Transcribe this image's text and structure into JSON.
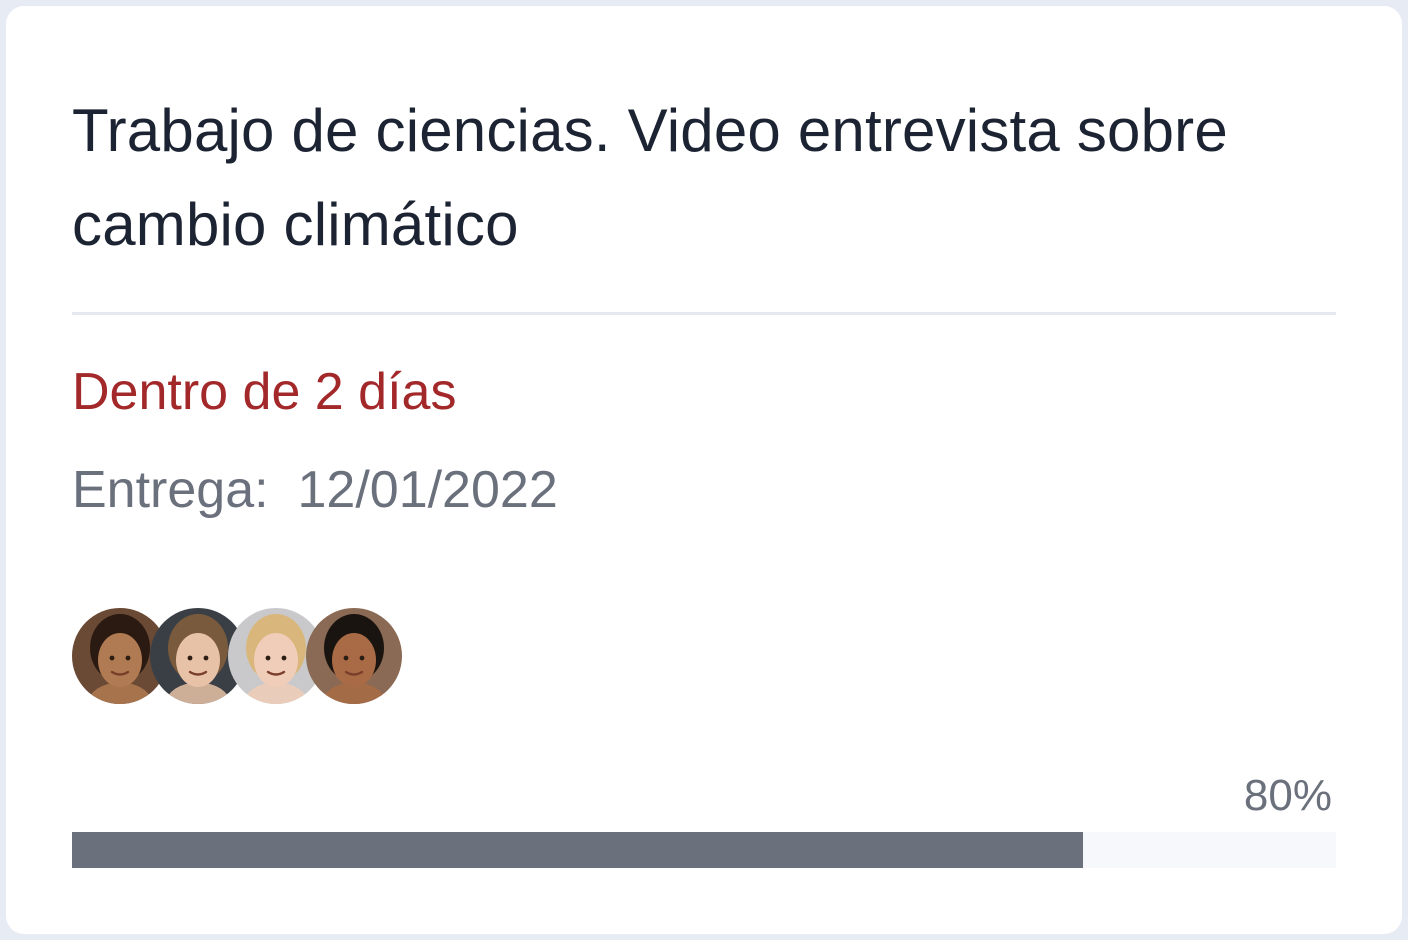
{
  "task": {
    "title": "Trabajo de ciencias. Video entrevista sobre cambio climático",
    "due_relative": "Dentro de 2 días",
    "due_label": "Entrega:",
    "due_date": "12/01/2022"
  },
  "members": [
    {
      "icon": "avatar-photo",
      "skin": "#b07a52",
      "hair": "#2a1a12",
      "bg": "#6a4a34"
    },
    {
      "icon": "avatar-photo",
      "skin": "#e8c2a6",
      "hair": "#7a5a3c",
      "bg": "#3a3f46"
    },
    {
      "icon": "avatar-photo",
      "skin": "#f0cdb8",
      "hair": "#d9b77c",
      "bg": "#c9c9cb"
    },
    {
      "icon": "avatar-photo",
      "skin": "#a86b45",
      "hair": "#1a1411",
      "bg": "#8a6a54"
    }
  ],
  "progress": {
    "value": 0.8,
    "label": "80%"
  },
  "colors": {
    "accent_due": "#a3282a",
    "progress_fill": "#6a707c",
    "progress_track": "#f7f8fb"
  }
}
